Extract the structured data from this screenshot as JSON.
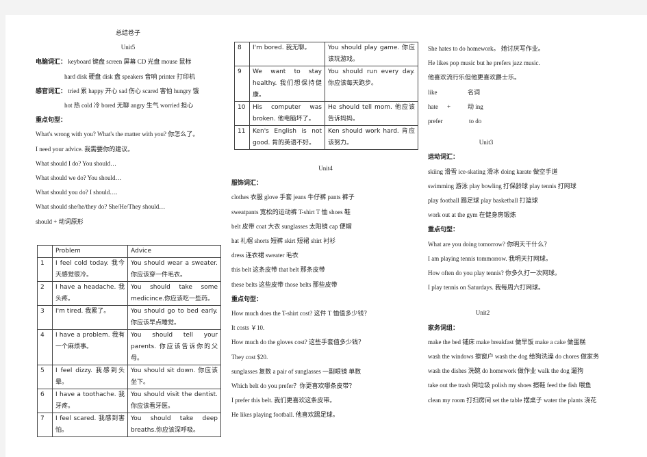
{
  "doc_title": "总结卷子",
  "unit5": {
    "title": "Unit5",
    "computer_vocab_label": "电脑词汇：",
    "computer_vocab_line1": "keyboard  键盘   screen  屏幕 CD  光盘 mouse  鼠标",
    "computer_vocab_line2": "hard disk  硬盘  disk  盘  speakers  音响  printer  打印机",
    "feeling_vocab_label": "感官词汇：",
    "feeling_vocab_line1": "tried 累  happy 开心  sad 伤心  scared 害怕  hungry 饿",
    "feeling_vocab_line2": "hot 热  cold 冷  bored 无聊  angry 生气    worried 担心",
    "key_sentences_label": "重点句型：",
    "sentences": [
      "What's wrong with you? What's the matter with you?  你怎么了。",
      "I need your advice.  我需要你的建议。",
      "What should I do?            You should…",
      "What should we do?          You should…",
      "What should you do?        I should….",
      "What should she/he/they do?    She/He/They should…",
      "should +  动词原形"
    ],
    "table_headers": [
      "",
      "Problem",
      "Advice"
    ],
    "table_rows": [
      {
        "num": "1",
        "problem": "I feel cold today. 我今天感觉很冷。",
        "advice": "You should wear a sweater. 你应该穿一件毛衣。"
      },
      {
        "num": "2",
        "problem": "I have a headache. 我头疼。",
        "advice": "You should take some medicince.你应该吃一些药。"
      },
      {
        "num": "3",
        "problem": "I'm tired. 我累了。",
        "advice": "You should go to bed early. 你应该早点睡觉。"
      },
      {
        "num": "4",
        "problem": "I have a problem. 我有一个麻烦事。",
        "advice": "You should tell your parents. 你应该告诉你的父母。"
      },
      {
        "num": "5",
        "problem": "I feel dizzy. 我感到头晕。",
        "advice": "You should sit down. 你应该坐下。"
      },
      {
        "num": "6",
        "problem": "I have a toothache. 我牙疼。",
        "advice": "You should visit the dentist. 你应该看牙医。"
      },
      {
        "num": "7",
        "problem": "I feel scared. 我感到害怕。",
        "advice": "You should take deep breaths.你应该深呼吸。"
      }
    ],
    "table_rows_cont": [
      {
        "num": "8",
        "problem": "I'm bored. 我无聊。",
        "advice": "You should play game. 你应该玩游戏。"
      },
      {
        "num": "9",
        "problem": "We want to stay healthy. 我们想保持健康。",
        "advice": "You should run every day. 你应该每天跑步。"
      },
      {
        "num": "10",
        "problem": "His computer was broken. 他电脑坏了。",
        "advice": "He should tell mom. 他应该告诉妈妈。"
      },
      {
        "num": "11",
        "problem": "Ken's English is not good. 肯的英语不好。",
        "advice": "Ken should work hard. 肯应该努力。"
      }
    ]
  },
  "unit4": {
    "title": "Unit4",
    "clothing_vocab_label": "服饰词汇：",
    "clothing_vocab": [
      "clothes 衣服       glove  手套       jeans 牛仔裤       pants 裤子",
      "sweatpants 宽松的运动裤        T-shirt  T  恤          shoes 鞋",
      "belt 皮带       coat  大衣         sunglasses 太阳镜      cap 便帽",
      "hat 礼帽         shorts 短裤        skirt 短裙                 shirt 衬衫",
      "dress 连衣裙      sweater 毛衣",
      "this  belt 这条皮带               that  belt   那条皮带",
      "these  belts   这些皮带            those  belts 那些皮带"
    ],
    "key_sentences_label": "重点句型：",
    "sentences": [
      "How much does the T-shirt cost?   这件 T 恤值多少钱？",
      "It costs   ￥10.",
      "How much do the gloves cost?   这些手套值多少钱？",
      "They cost $20.",
      "sunglasses     复数      a pair of sunglasses   一副眼镜  单数",
      "Which belt do you prefer？你更喜欢哪条皮带？",
      "I prefer this belt.  我们更喜欢这条皮带。",
      "He likes playing football.  他喜欢踢足球。"
    ]
  },
  "col3_top": {
    "sentences": [
      "She hates to do homework。  她讨厌写作业。",
      "He likes pop music but he prefers jazz music.",
      "他喜欢流行乐但他更喜欢爵士乐。"
    ],
    "grammar": [
      {
        "verb": "like",
        "plus": "",
        "form": "名词"
      },
      {
        "verb": "hate",
        "plus": "+",
        "form": "动 ing"
      },
      {
        "verb": "prefer",
        "plus": "",
        "form": "to do"
      }
    ]
  },
  "unit3": {
    "title": "Unit3",
    "sports_vocab_label": "运动词汇：",
    "sports_vocab": [
      "skiing 滑雪      ice-skating 滑冰           doing  karate 做空手道",
      "swimming 游泳    play  bowling 打保龄球    play  tennis   打网球",
      "play  football 踢足球      play  basketball 打篮球",
      "work  out  at  the  gym 在健身房锻炼"
    ],
    "key_sentences_label": "重点句型：",
    "sentences": [
      "What are you doing tomorrow?     你明天干什么？",
      "I am playing tennis tommorrow.   我明天打网球。",
      "How often do you play tennis?      你多久打一次网球。",
      "I play tennis on Saturdays.             我每周六打网球。"
    ]
  },
  "unit2": {
    "title": "Unit2",
    "chores_label": "家务词组：",
    "chores": [
      "make  the  bed 铺床        make  breakfast 做早饭    make  a  cake 做蛋糕",
      "wash  the  windows 擦窗户  wash  the  dog 给狗洗澡 do  chores 做家务",
      "wash  the  dishes 洗碗      do  homework 做作业    walk  the  dog 遛狗",
      "take  out  the  trash 倒垃圾    polish  my  shoes 擦鞋  feed  the  fish   喂鱼",
      "clean  my  room 打扫房间  set  the  table 摆桌子  water  the  plants 浇花"
    ]
  }
}
